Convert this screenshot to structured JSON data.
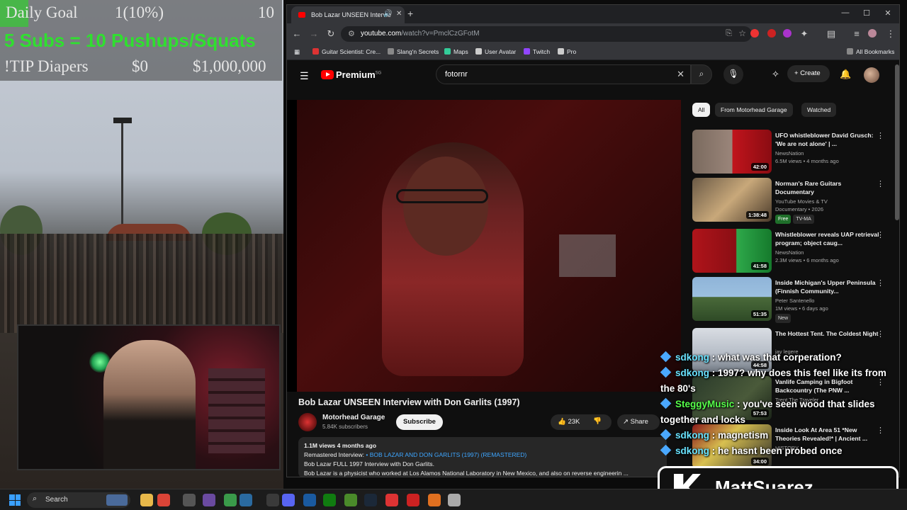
{
  "overlay": {
    "goal_label": "Daily Goal",
    "goal_progress": "1(10%)",
    "goal_target": "10",
    "goal_fraction": 0.1,
    "subs_text": "5 Subs = 10 Pushups/Squats",
    "tip_label": "!TIP Diapers",
    "tip_current": "$0",
    "tip_target": "$1,000,000"
  },
  "browser": {
    "tab_title": "Bob Lazar UNSEEN Intervie",
    "new_tab": "+",
    "url_host": "youtube.com",
    "url_path": "/watch?v=PmclCzGFotM",
    "bookmarks": [
      {
        "label": "Guitar Scientist: Cre...",
        "color": "#d33"
      },
      {
        "label": "Slang'n Secrets",
        "color": "#888"
      },
      {
        "label": "Maps",
        "color": "#3c9"
      },
      {
        "label": "User Avatar",
        "color": "#ccc"
      },
      {
        "label": "Twitch",
        "color": "#9146ff"
      },
      {
        "label": "Pro",
        "color": "#ccc"
      }
    ],
    "all_bookmarks": "All Bookmarks"
  },
  "youtube": {
    "logo": "Premium",
    "logo_region": "SG",
    "search_value": "fotornr",
    "create_label": "Create",
    "video_title": "Bob Lazar UNSEEN Interview with Don Garlits (1997)",
    "channel_name": "Motorhead Garage",
    "channel_subs": "5.84K subscribers",
    "subscribe_label": "Subscribe",
    "likes": "23K",
    "share_label": "Share",
    "desc_views": "1.1M views  4 months ago",
    "desc_line1_prefix": "Remastered Interview: ",
    "desc_line1_link": "• BOB LAZAR AND DON GARLITS (1997) (REMASTERED)",
    "desc_line2": "Bob Lazar FULL 1997 Interview with Don Garlits.",
    "desc_line3": "Bob Lazar is a physicist who worked at Los Alamos National Laboratory in New Mexico, and also on reverse engineerin ...",
    "chips": [
      "All",
      "From Motorhead Garage",
      "Watched"
    ],
    "recommendations": [
      {
        "title": "UFO whistleblower David Grusch: 'We are not alone' | ...",
        "channel": "NewsNation",
        "meta": "6.5M views • 4 months ago",
        "duration": "42:00",
        "thumb": "linear-gradient(90deg,#7a6a5e 0%,#9a857a 50%,#c0141c 51%,#8a0c12 100%)"
      },
      {
        "title": "Norman's Rare Guitars Documentary",
        "channel": "YouTube Movies & TV",
        "meta": "Documentary • 2026",
        "duration": "1:38:48",
        "badge1": "Free",
        "badge2": "TV-MA",
        "thumb": "linear-gradient(135deg,#6b5a46 0%,#c8a87a 50%,#4a3a2a 100%)"
      },
      {
        "title": "Whistleblower reveals UAP retrieval program; object caug...",
        "channel": "NewsNation",
        "meta": "2.3M views • 6 months ago",
        "duration": "41:58",
        "thumb": "linear-gradient(90deg,#b0141a 0%,#8a0e14 55%,#2ea84a 56%,#157a2c 100%)"
      },
      {
        "title": "Inside Michigan's Upper Peninsula (Finnish Community...",
        "channel": "Peter Santenello",
        "meta": "1M views • 6 days ago",
        "duration": "51:35",
        "badge2": "New",
        "thumb": "linear-gradient(180deg,#8fb4d8 0%,#9cc0e0 45%,#4a6a3a 46%,#2e4a26 100%)"
      },
      {
        "title": "The Hottest Tent. The Coldest Night",
        "channel": "jay legere",
        "meta": "",
        "duration": "44:58",
        "thumb": "linear-gradient(180deg,#d9dde3 0%,#b5bcc6 60%,#6f7781 100%)"
      },
      {
        "title": "Vanlife Camping in Bigfoot Backcountry (The PNW ...",
        "channel": "Trent The Traveler",
        "meta": "",
        "duration": "57:53",
        "thumb": "linear-gradient(135deg,#2a3a2a 0%,#4a5a3a 60%,#1a2418 100%)"
      },
      {
        "title": "Inside Look At Area 51 *New Theories Revealed!* | Ancient ...",
        "channel": "HISTORY",
        "meta": "",
        "duration": "34:00",
        "thumb": "linear-gradient(135deg,#8a1a1a 0%,#d8c050 40%,#2a2a2a 100%)"
      }
    ]
  },
  "chat": [
    {
      "user": "sdkong",
      "text": " : what was that corperation?",
      "green": false
    },
    {
      "user": "sdkong",
      "text": " : 1997? why does this feel like its from the 80's",
      "green": false
    },
    {
      "user": "SteggyMusic",
      "text": " : you've seen wood that slides together and locks",
      "green": true
    },
    {
      "user": "sdkong",
      "text": " : magnetism",
      "green": false
    },
    {
      "user": "sdkong",
      "text": " : he hasnt been probed once",
      "green": false
    }
  ],
  "brand": {
    "name": "MattSuarez"
  },
  "taskbar": {
    "search_label": "Search"
  }
}
